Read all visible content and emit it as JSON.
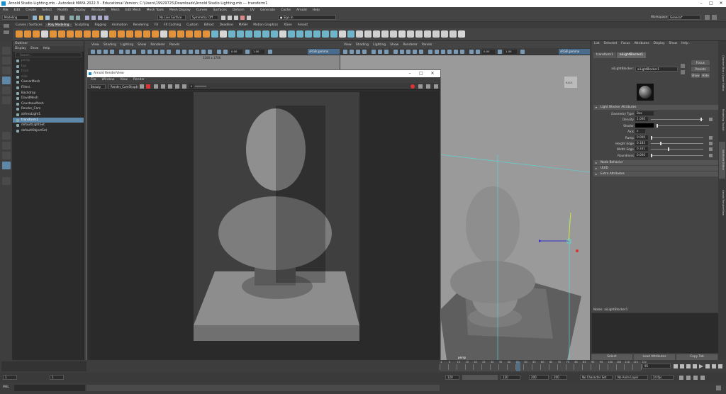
{
  "window": {
    "title": "Arnold Studio Lighting.mb - Autodesk MAYA 2022.3 - Educational Version: C:\\Users\\19929725\\Downloads\\Arnold Studio Lighting.mb  ---  transform1"
  },
  "menubar": [
    "File",
    "Edit",
    "Create",
    "Select",
    "Modify",
    "Display",
    "Windows",
    "Mesh",
    "Edit Mesh",
    "Mesh Tools",
    "Mesh Display",
    "Curves",
    "Surfaces",
    "Deform",
    "UV",
    "Generate",
    "Cache",
    "Arnold",
    "Help"
  ],
  "statusline": {
    "mode": "Modeling",
    "live_surface": "No Live Surface",
    "symmetry": "Symmetry: Off",
    "sign_in": "Sign In",
    "workspace_label": "Workspace :",
    "workspace_value": "General*"
  },
  "shelf_tabs": [
    "Curves / Surfaces",
    "Poly Modeling",
    "Sculpting",
    "Rigging",
    "Animation",
    "Rendering",
    "FX",
    "FX Caching",
    "Custom",
    "Bifrost",
    "Deadline",
    "MASH",
    "Motion Graphics",
    "XGen",
    "Arnold"
  ],
  "shelf_active": "Poly Modeling",
  "outliner": {
    "title": "Outliner",
    "menu": [
      "Display",
      "Show",
      "Help"
    ],
    "search_placeholder": "Search...",
    "items": [
      {
        "label": "persp",
        "state": "dim"
      },
      {
        "label": "top",
        "state": "dim"
      },
      {
        "label": "front",
        "state": "dim"
      },
      {
        "label": "side",
        "state": "dim"
      },
      {
        "label": "CaesarMesh",
        "state": "normal"
      },
      {
        "label": "Fillers",
        "state": "normal"
      },
      {
        "label": "Backdrop",
        "state": "normal"
      },
      {
        "label": "DavidMesh",
        "state": "normal"
      },
      {
        "label": "CousteauMesh",
        "state": "normal"
      },
      {
        "label": "Render_Cam",
        "state": "normal"
      },
      {
        "label": "aiAreaLight1",
        "state": "normal"
      },
      {
        "label": "transform1",
        "state": "selected"
      },
      {
        "label": "defaultLightSet",
        "state": "normal"
      },
      {
        "label": "defaultObjectSet",
        "state": "normal"
      }
    ]
  },
  "viewport_left": {
    "menu": [
      "View",
      "Shading",
      "Lighting",
      "Show",
      "Renderer",
      "Panels"
    ],
    "resolution": "1280 x 1706",
    "field1": "0.00",
    "field2": "1.00",
    "gamma": "sRGB gamma (legacy)"
  },
  "viewport_right": {
    "menu": [
      "View",
      "Shading",
      "Lighting",
      "Show",
      "Renderer",
      "Panels"
    ],
    "field1": "0.00",
    "field2": "1.00",
    "gamma": "sRGB gamma (legacy)",
    "camera_label": "persp",
    "cube_label": "BACK"
  },
  "render_view": {
    "title": "Arnold RenderView",
    "menu": [
      "File",
      "Window",
      "View",
      "Render"
    ],
    "channel": "Beauty",
    "camera": "Render_CamShape",
    "exposure": "0"
  },
  "attribute_editor": {
    "menu": [
      "List",
      "Selected",
      "Focus",
      "Attributes",
      "Display",
      "Show",
      "Help"
    ],
    "tabs": [
      "transform1",
      "aiLightBlocker1"
    ],
    "node_label": "aiLightBlocker:",
    "node_value": "aiLightBlocker1",
    "buttons": {
      "focus": "Focus",
      "presets": "Presets",
      "show": "Show",
      "hide": "Hide"
    },
    "section_main": "Light Blocker Attributes",
    "attributes": [
      {
        "label": "Geometry Type",
        "value": "Box",
        "kind": "dropdown"
      },
      {
        "label": "Density",
        "value": "1.000",
        "kind": "slider",
        "fraction": 0.97
      },
      {
        "label": "Shader",
        "value": "",
        "kind": "color"
      },
      {
        "label": "Axis",
        "value": "x",
        "kind": "dropdown"
      },
      {
        "label": "Ramp",
        "value": "0.000",
        "kind": "slider",
        "fraction": 0.0
      },
      {
        "label": "Height Edge",
        "value": "0.183",
        "kind": "slider",
        "fraction": 0.18
      },
      {
        "label": "Width Edge",
        "value": "0.331",
        "kind": "slider",
        "fraction": 0.33
      },
      {
        "label": "Roundness",
        "value": "0.000",
        "kind": "slider",
        "fraction": 0.0
      }
    ],
    "sections": [
      "Node Behavior",
      "UUID",
      "Extra Attributes"
    ],
    "notes_label": "Notes:  aiLightBlocker1",
    "bottom_buttons": [
      "Select",
      "Load Attributes",
      "Copy Tab"
    ]
  },
  "side_tabs": [
    "Channel Box / Layer Editor",
    "Modeling Toolkit",
    "Attribute Editor",
    "Arnold RenderView"
  ],
  "timeline": {
    "ticks": [
      "1",
      "5",
      "10",
      "15",
      "20",
      "25",
      "30",
      "35",
      "40",
      "45",
      "50",
      "55",
      "60",
      "65",
      "70",
      "75",
      "80",
      "85",
      "90",
      "95",
      "100",
      "105",
      "110",
      "115",
      "120"
    ],
    "current_frame": "1",
    "current_field": "95"
  },
  "range": {
    "start": "1",
    "start2": "1",
    "end1": "120",
    "end2": "200",
    "inner_start": "120",
    "inner_end": "200",
    "character": "No Character Set",
    "anim_layer": "No Anim Layer",
    "fps": "24 fps"
  },
  "cmdline": {
    "lang": "MEL"
  },
  "colors": {
    "accent": "#5f87a8",
    "maya_logo": "#1c8dc8",
    "shelf_orange": "#e2923a"
  }
}
